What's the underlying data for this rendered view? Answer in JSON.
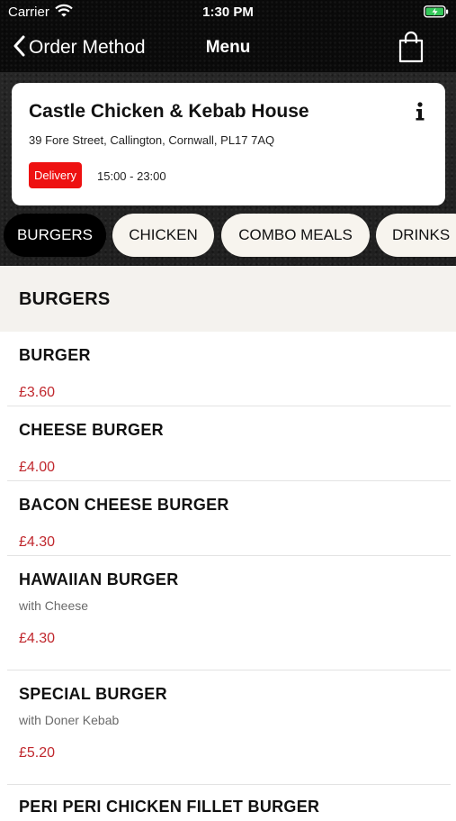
{
  "status_bar": {
    "carrier": "Carrier",
    "time": "1:30 PM"
  },
  "nav": {
    "back_label": "Order Method",
    "title": "Menu"
  },
  "restaurant": {
    "name": "Castle Chicken & Kebab House",
    "address": "39 Fore Street, Callington, Cornwall, PL17 7AQ",
    "badge": "Delivery",
    "hours": "15:00 - 23:00"
  },
  "tabs": [
    {
      "label": "BURGERS",
      "active": true
    },
    {
      "label": "CHICKEN",
      "active": false
    },
    {
      "label": "COMBO MEALS",
      "active": false
    },
    {
      "label": "DRINKS",
      "active": false
    }
  ],
  "section": {
    "title": "BURGERS"
  },
  "menu_items": [
    {
      "name": "BURGER",
      "description": "",
      "price": "£3.60"
    },
    {
      "name": "CHEESE BURGER",
      "description": "",
      "price": "£4.00"
    },
    {
      "name": "BACON CHEESE BURGER",
      "description": "",
      "price": "£4.30"
    },
    {
      "name": "HAWAIIAN BURGER",
      "description": "with Cheese",
      "price": "£4.30"
    },
    {
      "name": "SPECIAL BURGER",
      "description": "with Doner Kebab",
      "price": "£5.20"
    },
    {
      "name": "PERI PERI CHICKEN FILLET BURGER",
      "description": "",
      "price": ""
    }
  ],
  "colors": {
    "accent_red": "#ee1111",
    "price_red": "#c0272d",
    "active_tab": "#000000",
    "inactive_tab": "#f7f4ee"
  }
}
